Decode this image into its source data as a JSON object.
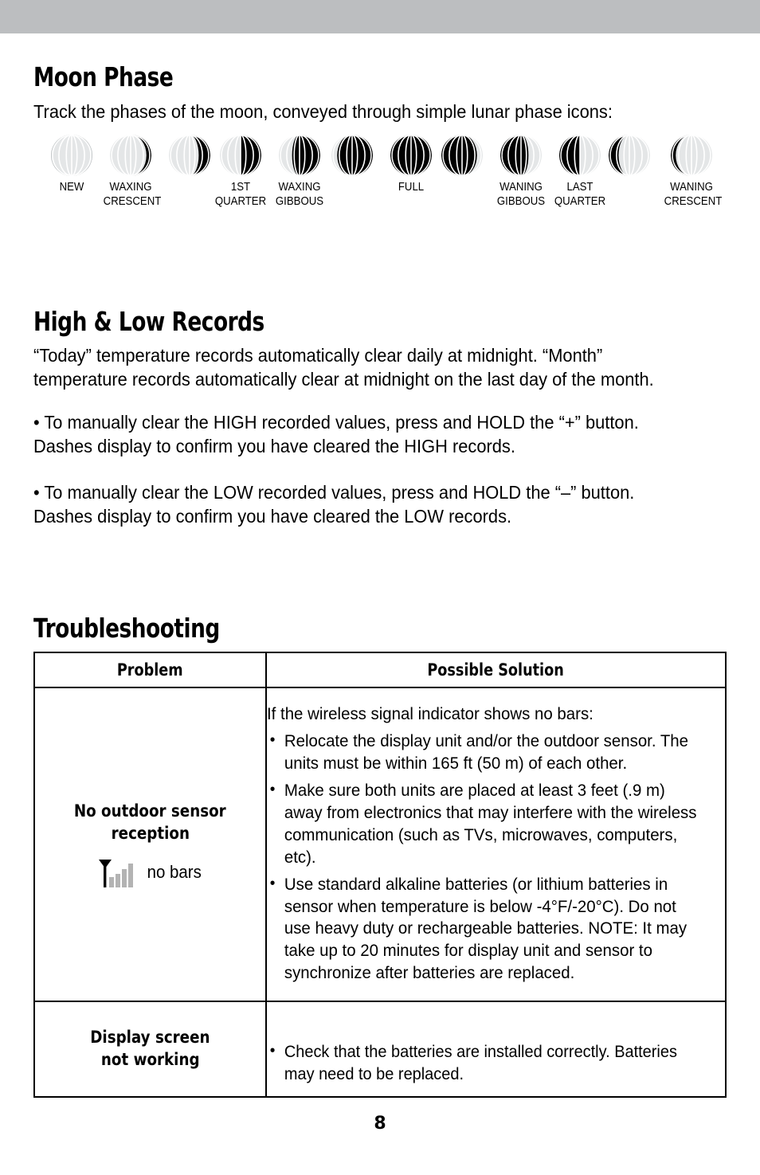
{
  "page": {
    "number": "8",
    "top_band_color": "#bcbec0"
  },
  "moon_phase": {
    "heading": "Moon Phase",
    "intro": "Track the phases of the moon, conveyed through simple lunar phase icons:",
    "icons": [
      {
        "name": "new-moon",
        "label": "NEW",
        "illumination": 0.0,
        "waxing": true
      },
      {
        "name": "waxing-crescent-early",
        "label": "WAXING\nCRESCENT",
        "illumination": 0.12,
        "waxing": true
      },
      {
        "name": "waxing-crescent-late",
        "label": "",
        "illumination": 0.28,
        "waxing": true
      },
      {
        "name": "first-quarter",
        "label": "1ST\nQUARTER",
        "illumination": 0.5,
        "waxing": true
      },
      {
        "name": "waxing-gibbous-early",
        "label": "WAXING\nGIBBOUS",
        "illumination": 0.68,
        "waxing": true
      },
      {
        "name": "waxing-gibbous-late",
        "label": "",
        "illumination": 0.86,
        "waxing": true
      },
      {
        "name": "full-moon",
        "label": "FULL",
        "illumination": 1.0,
        "waxing": true
      },
      {
        "name": "waning-gibbous-early",
        "label": "",
        "illumination": 0.86,
        "waxing": false
      },
      {
        "name": "waning-gibbous-late",
        "label": "WANING\nGIBBOUS",
        "illumination": 0.68,
        "waxing": false
      },
      {
        "name": "last-quarter",
        "label": "LAST\nQUARTER",
        "illumination": 0.5,
        "waxing": false
      },
      {
        "name": "waning-crescent-early",
        "label": "",
        "illumination": 0.24,
        "waxing": false
      },
      {
        "name": "waning-crescent-late",
        "label": "WANING\nCRESCENT",
        "illumination": 0.12,
        "waxing": false
      }
    ]
  },
  "records": {
    "heading": "High & Low Records",
    "paragraph": "“Today” temperature records automatically clear daily at midnight. “Month” temperature records automatically clear at midnight on the last day of the month.",
    "bullet_high": "• To manually clear the HIGH recorded values, press and HOLD the “+” button. Dashes display to confirm you have cleared the HIGH records.",
    "bullet_low": "• To manually clear the LOW recorded values, press and HOLD the “–” button. Dashes display to confirm you have cleared the LOW records."
  },
  "troubleshooting": {
    "heading": "Troubleshooting",
    "columns": [
      "Problem",
      "Possible Solution"
    ],
    "rows": [
      {
        "problem": "No outdoor sensor\nreception",
        "icon": "signal-bars-icon",
        "icon_caption": "no bars",
        "solution_lead": "If the wireless signal indicator shows no bars:",
        "solution_bullets": [
          "Relocate the display unit and/or the outdoor sensor. The units must be within 165 ft (50 m) of each other.",
          "Make sure both units are placed at least 3 feet (.9 m) away from electronics that may interfere with the wireless communication (such as TVs, microwaves, computers, etc).",
          "Use standard alkaline batteries (or lithium batteries in sensor when temperature is below -4°F/-20°C). Do not use heavy duty or rechargeable batteries. NOTE: It may take up to 20 minutes for display unit and sensor to synchronize after batteries are replaced."
        ]
      },
      {
        "problem": "Display screen\nnot working",
        "icon": "",
        "icon_caption": "",
        "solution_lead": "",
        "solution_bullets": [
          "Check that the batteries are installed correctly. Batteries may need to be replaced."
        ]
      }
    ]
  }
}
